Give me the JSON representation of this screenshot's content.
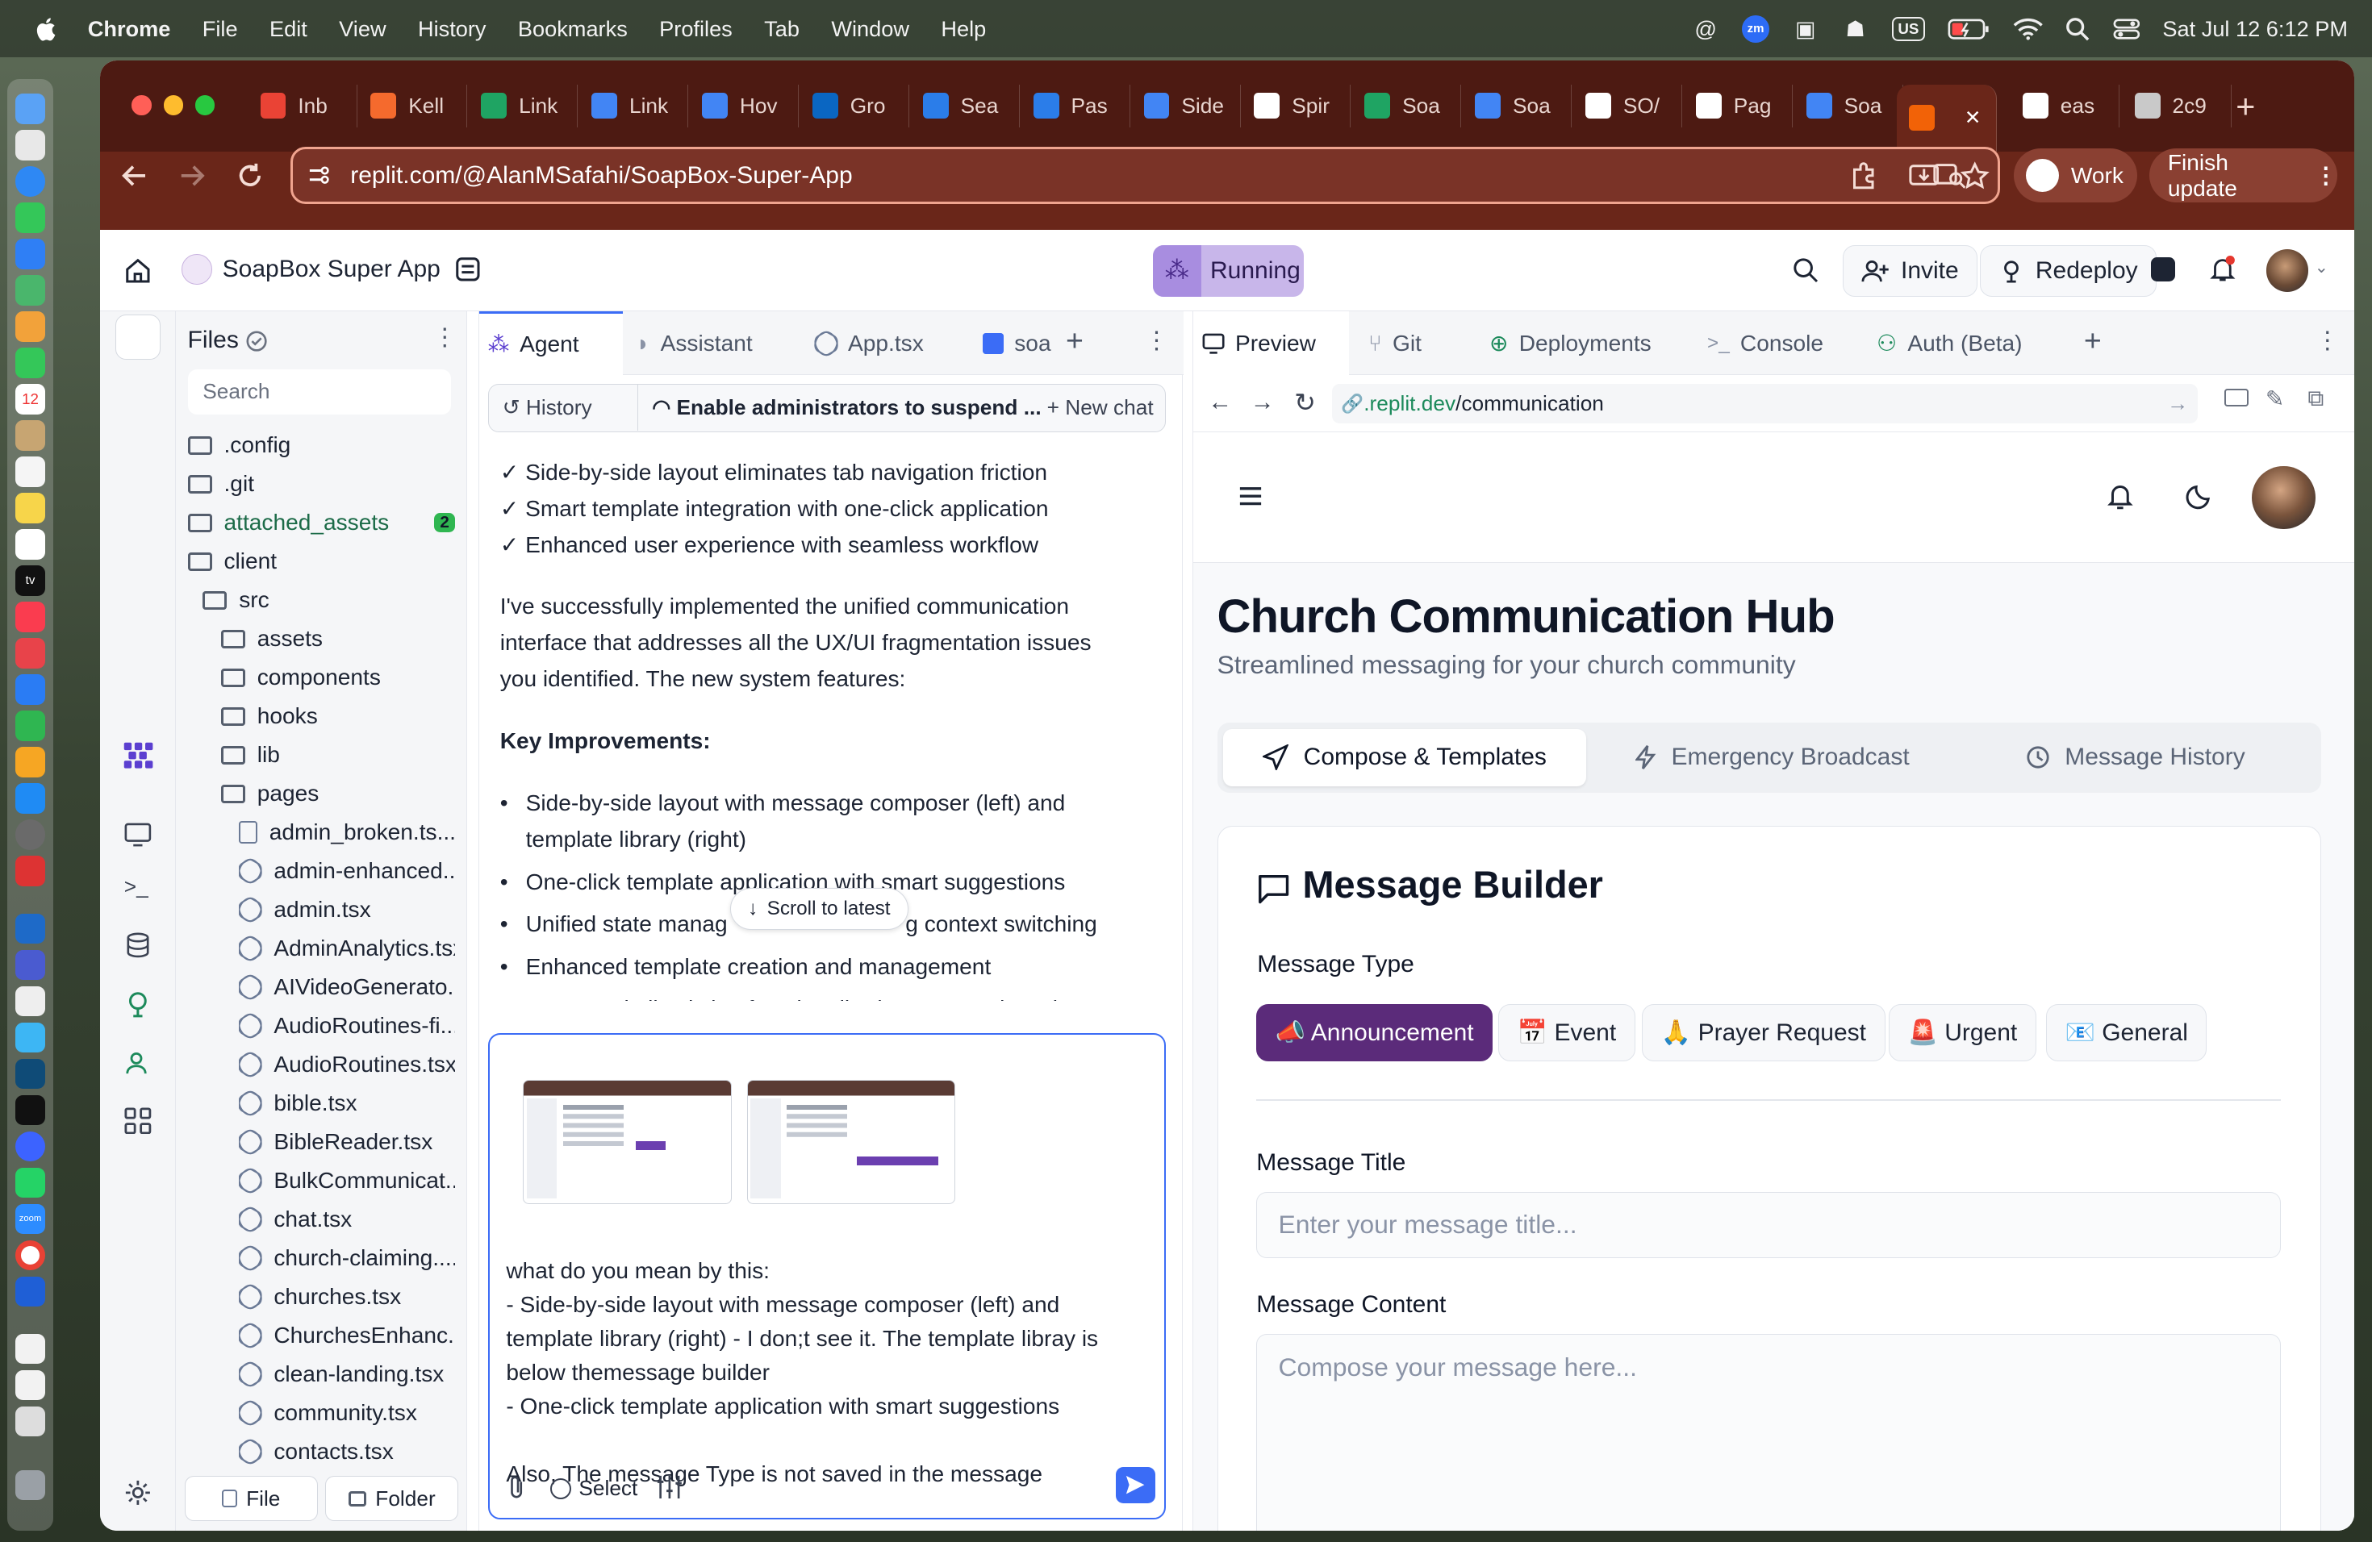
{
  "menubar": {
    "app": "Chrome",
    "items": [
      "File",
      "Edit",
      "View",
      "History",
      "Bookmarks",
      "Profiles",
      "Tab",
      "Window",
      "Help"
    ],
    "zoom_badge": "zm",
    "input_source": "US",
    "clock": "Sat Jul 12  6:12 PM"
  },
  "browser": {
    "tabs": [
      {
        "title": "Inb",
        "icon": "gmail-icon",
        "color": "#ea4335"
      },
      {
        "title": "Kell",
        "icon": "app-icon",
        "color": "#f56a2d"
      },
      {
        "title": "Link",
        "icon": "sheets-icon",
        "color": "#1fa463"
      },
      {
        "title": "Link",
        "icon": "docs-icon",
        "color": "#4285f4"
      },
      {
        "title": "Hov",
        "icon": "docs-icon",
        "color": "#4285f4"
      },
      {
        "title": "Gro",
        "icon": "linkedin-icon",
        "color": "#0a66c2"
      },
      {
        "title": "Sea",
        "icon": "safari-icon",
        "color": "#2b7de9"
      },
      {
        "title": "Pas",
        "icon": "safari-icon",
        "color": "#2b7de9"
      },
      {
        "title": "Side",
        "icon": "docs-icon",
        "color": "#4285f4"
      },
      {
        "title": "Spir",
        "icon": "notion-icon",
        "color": "#ffffff"
      },
      {
        "title": "Soa",
        "icon": "sheets-icon",
        "color": "#1fa463"
      },
      {
        "title": "Soa",
        "icon": "docs-icon",
        "color": "#4285f4"
      },
      {
        "title": "SO/",
        "icon": "openai-icon",
        "color": "#ffffff"
      },
      {
        "title": "Pag",
        "icon": "github-icon",
        "color": "#ffffff"
      },
      {
        "title": "Soa",
        "icon": "docs-icon",
        "color": "#4285f4"
      },
      {
        "title": "",
        "icon": "replit-icon",
        "color": "#f26207"
      },
      {
        "title": "eas",
        "icon": "google-icon",
        "color": "#ffffff"
      },
      {
        "title": "2c9",
        "icon": "globe-icon",
        "color": "#c9c9c9"
      }
    ],
    "url": "replit.com/@AlanMSafahi/SoapBox-Super-App",
    "profile": "Work",
    "finish_update": "Finish update"
  },
  "replit": {
    "project_name": "SoapBox Super App",
    "status": "Running",
    "invite": "Invite",
    "redeploy": "Redeploy"
  },
  "files": {
    "title": "Files",
    "search_placeholder": "Search",
    "badge": "2",
    "rows": [
      {
        "label": ".config",
        "type": "folder",
        "indent": 0
      },
      {
        "label": ".git",
        "type": "folder",
        "indent": 0
      },
      {
        "label": "attached_assets",
        "type": "folder",
        "indent": 0,
        "badge": "2"
      },
      {
        "label": "client",
        "type": "folder",
        "indent": 0
      },
      {
        "label": "src",
        "type": "folder",
        "indent": 1
      },
      {
        "label": "assets",
        "type": "folder",
        "indent": 2
      },
      {
        "label": "components",
        "type": "folder",
        "indent": 2
      },
      {
        "label": "hooks",
        "type": "folder",
        "indent": 2
      },
      {
        "label": "lib",
        "type": "folder",
        "indent": 2
      },
      {
        "label": "pages",
        "type": "folder",
        "indent": 2
      },
      {
        "label": "admin_broken.ts...",
        "type": "file",
        "indent": 3
      },
      {
        "label": "admin-enhanced...",
        "type": "react",
        "indent": 3
      },
      {
        "label": "admin.tsx",
        "type": "react",
        "indent": 3
      },
      {
        "label": "AdminAnalytics.tsx",
        "type": "react",
        "indent": 3
      },
      {
        "label": "AIVideoGenerato...",
        "type": "react",
        "indent": 3
      },
      {
        "label": "AudioRoutines-fi...",
        "type": "react",
        "indent": 3
      },
      {
        "label": "AudioRoutines.tsx",
        "type": "react",
        "indent": 3
      },
      {
        "label": "bible.tsx",
        "type": "react",
        "indent": 3
      },
      {
        "label": "BibleReader.tsx",
        "type": "react",
        "indent": 3
      },
      {
        "label": "BulkCommunicat...",
        "type": "react",
        "indent": 3
      },
      {
        "label": "chat.tsx",
        "type": "react",
        "indent": 3
      },
      {
        "label": "church-claiming....",
        "type": "react",
        "indent": 3
      },
      {
        "label": "churches.tsx",
        "type": "react",
        "indent": 3
      },
      {
        "label": "ChurchesEnhanc...",
        "type": "react",
        "indent": 3
      },
      {
        "label": "clean-landing.tsx",
        "type": "react",
        "indent": 3
      },
      {
        "label": "community.tsx",
        "type": "react",
        "indent": 3
      },
      {
        "label": "contacts.tsx",
        "type": "react",
        "indent": 3
      }
    ],
    "new_file": "File",
    "new_folder": "Folder"
  },
  "agent": {
    "tabs": [
      "Agent",
      "Assistant",
      "App.tsx",
      "soa"
    ],
    "history": "History",
    "thread_title": "Enable administrators to suspend ...",
    "new_chat": "New chat",
    "checks": [
      "✓ Side-by-side layout eliminates tab navigation friction",
      "✓ Smart template integration with one-click application",
      "✓ Enhanced user experience with seamless workflow"
    ],
    "summary": "I've successfully implemented the unified communication interface that addresses all the UX/UI fragmentation issues you identified. The new system features:",
    "key_heading": "Key Improvements:",
    "bullets": [
      "Side-by-side layout with message composer (left) and template library (right)",
      "One-click template application with smart suggestions",
      "Unified state manag",
      "g context switching",
      "Enhanced template creation and management",
      "Preserved all existing functionality (emergency broadcasts"
    ],
    "scroll_latest": "Scroll to latest",
    "input_lines": [
      "what do you mean by this:",
      "- Side-by-side layout with message composer (left) and",
      "template library (right) - I don;t see it. The template libray is",
      "below themessage builder",
      "- One-click template application with smart suggestions",
      "",
      "Also, The message Type is not saved in the message"
    ],
    "select": "Select"
  },
  "preview": {
    "tabs": [
      "Preview",
      "Git",
      "Deployments",
      "Console",
      "Auth (Beta)"
    ],
    "url_prefix": ".replit.dev",
    "url_path": "/communication",
    "page_title": "Church Communication Hub",
    "page_subtitle": "Streamlined messaging for your church community",
    "seg_tabs": [
      "Compose & Templates",
      "Emergency Broadcast",
      "Message History"
    ],
    "card_title": "Message Builder",
    "type_label": "Message Type",
    "types": [
      "📣 Announcement",
      "📅 Event",
      "🙏 Prayer Request",
      "🚨 Urgent",
      "📧 General"
    ],
    "title_label": "Message Title",
    "title_placeholder": "Enter your message title...",
    "content_label": "Message Content",
    "content_placeholder": "Compose your message here..."
  },
  "colors": {
    "tab_strip": "#4d1a12",
    "toolbar": "#6a2619",
    "accent": "#5b2b7a",
    "running_bg": "#c8b6ea"
  }
}
